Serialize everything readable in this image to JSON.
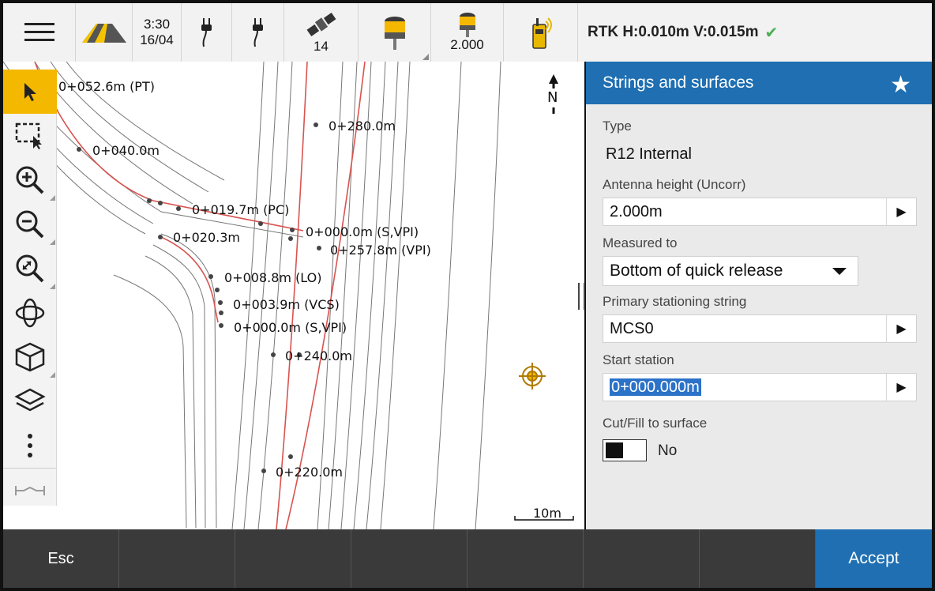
{
  "status_bar": {
    "time": "3:30",
    "date": "16/04",
    "satellites": "14",
    "antenna_height": "2.000",
    "rtk_status": "RTK H:0.010m V:0.015m"
  },
  "map": {
    "labels": [
      "0+052.6m (PT)",
      "0+040.0m",
      "0+019.7m (PC)",
      "0+020.3m",
      "0+000.0m (S,VPI)",
      "0+257.8m (VPI)",
      "0+008.8m (LO)",
      "0+003.9m (VCS)",
      "0+000.0m (S,VPI)",
      "0+280.0m",
      "0+240.0m",
      "0+220.0m"
    ],
    "north_label": "N",
    "scale_label": "10m"
  },
  "panel": {
    "title": "Strings and surfaces",
    "type_label": "Type",
    "type_value": "R12 Internal",
    "antenna_label": "Antenna height (Uncorr)",
    "antenna_value": "2.000m",
    "measured_label": "Measured to",
    "measured_value": "Bottom of quick release",
    "primary_label": "Primary stationing string",
    "primary_value": "MCS0",
    "start_label": "Start station",
    "start_value": "0+000.000m",
    "cutfill_label": "Cut/Fill to surface",
    "cutfill_value": "No"
  },
  "bottom": {
    "esc": "Esc",
    "accept": "Accept"
  }
}
